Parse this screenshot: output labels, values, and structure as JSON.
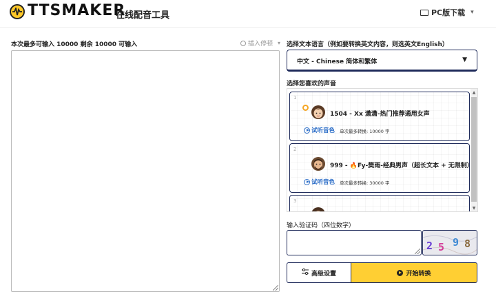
{
  "header": {
    "logo_text": "TTSMAKER",
    "tagline": "在线配音工具",
    "pc_download": "PC版下载"
  },
  "editor": {
    "limit_text": "本次最多可输入 10000 剩余 10000 可输入",
    "pause_label": "插入停顿",
    "text_value": ""
  },
  "language": {
    "label": "选择文本语言（例如要转换英文内容，则选英文English）",
    "selected": "中文 - Chinese 简体和繁体"
  },
  "voices": {
    "label": "选择您喜欢的声音",
    "items": [
      {
        "index": "1",
        "name": "1504 - Xx 潇潇-热门推荐通用女声",
        "listen": "试听音色",
        "limit": "单次最多转换: 10000 字"
      },
      {
        "index": "2",
        "name": "999 - 🔥Fy-樊雨-经典男声（超长文本 + 无限制）",
        "listen": "试听音色",
        "limit": "单次最多转换: 30000 字"
      },
      {
        "index": "3",
        "name": "",
        "listen": "",
        "limit": ""
      }
    ]
  },
  "captcha": {
    "label": "输入验证码（四位数字）",
    "input_value": "",
    "digits": [
      "2",
      "5",
      "9",
      "8"
    ],
    "digit_colors": [
      "#6a3fd4",
      "#d43f9a",
      "#3f8ad4",
      "#8a6a3f"
    ]
  },
  "actions": {
    "advanced": "高级设置",
    "start": "开始转换"
  },
  "colors": {
    "accent_yellow": "#ffcf33",
    "border_navy": "#1e2a5a",
    "link_blue": "#2a6cc7"
  }
}
